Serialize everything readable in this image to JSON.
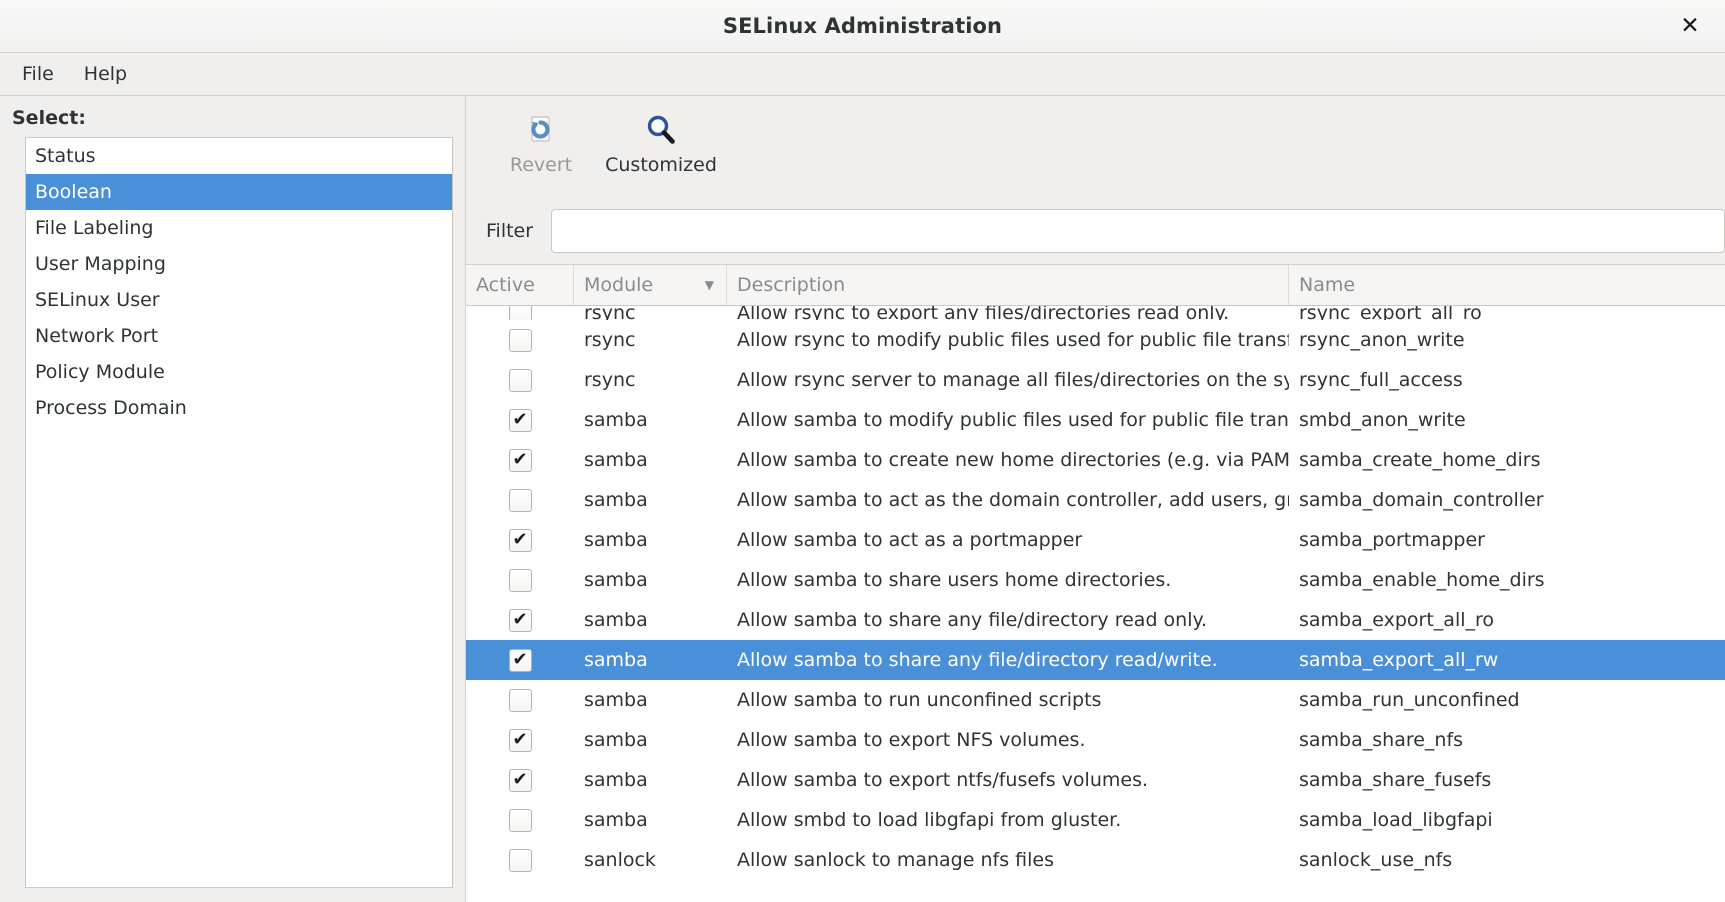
{
  "window": {
    "title": "SELinux Administration",
    "close_icon": "close-icon",
    "close_glyph": "✕"
  },
  "menubar": {
    "items": [
      {
        "label": "File"
      },
      {
        "label": "Help"
      }
    ]
  },
  "sidebar": {
    "select_label": "Select:",
    "items": [
      {
        "label": "Status",
        "selected": false
      },
      {
        "label": "Boolean",
        "selected": true
      },
      {
        "label": "File Labeling",
        "selected": false
      },
      {
        "label": "User Mapping",
        "selected": false
      },
      {
        "label": "SELinux User",
        "selected": false
      },
      {
        "label": "Network Port",
        "selected": false
      },
      {
        "label": "Policy Module",
        "selected": false
      },
      {
        "label": "Process Domain",
        "selected": false
      }
    ]
  },
  "toolbar": {
    "buttons": [
      {
        "label": "Revert",
        "icon": "revert-icon",
        "enabled": false
      },
      {
        "label": "Customized",
        "icon": "magnifier-icon",
        "enabled": true
      }
    ]
  },
  "filter": {
    "label": "Filter",
    "value": "",
    "placeholder": ""
  },
  "table": {
    "columns": [
      {
        "key": "active",
        "label": "Active",
        "sorted": false
      },
      {
        "key": "module",
        "label": "Module",
        "sorted": true,
        "sort_dir": "desc",
        "sort_glyph": "▼"
      },
      {
        "key": "description",
        "label": "Description",
        "sorted": false
      },
      {
        "key": "name",
        "label": "Name",
        "sorted": false
      }
    ],
    "rows": [
      {
        "active": false,
        "module": "rsync",
        "description": "Allow rsync to export any files/directories read only.",
        "name": "rsync_export_all_ro",
        "selected": false,
        "clipped": true
      },
      {
        "active": false,
        "module": "rsync",
        "description": "Allow rsync to modify public files used for public file transfer services.",
        "name": "rsync_anon_write",
        "selected": false
      },
      {
        "active": false,
        "module": "rsync",
        "description": "Allow rsync server to manage all files/directories on the system.",
        "name": "rsync_full_access",
        "selected": false
      },
      {
        "active": true,
        "module": "samba",
        "description": "Allow samba to modify public files used for public file transfer services.",
        "name": "smbd_anon_write",
        "selected": false
      },
      {
        "active": true,
        "module": "samba",
        "description": "Allow samba to create new home directories (e.g. via PAM)",
        "name": "samba_create_home_dirs",
        "selected": false
      },
      {
        "active": false,
        "module": "samba",
        "description": "Allow samba to act as the domain controller, add users, groups and change passwords.",
        "name": "samba_domain_controller",
        "selected": false
      },
      {
        "active": true,
        "module": "samba",
        "description": "Allow samba to act as a portmapper",
        "name": "samba_portmapper",
        "selected": false
      },
      {
        "active": false,
        "module": "samba",
        "description": "Allow samba to share users home directories.",
        "name": "samba_enable_home_dirs",
        "selected": false
      },
      {
        "active": true,
        "module": "samba",
        "description": "Allow samba to share any file/directory read only.",
        "name": "samba_export_all_ro",
        "selected": false
      },
      {
        "active": true,
        "module": "samba",
        "description": "Allow samba to share any file/directory read/write.",
        "name": "samba_export_all_rw",
        "selected": true
      },
      {
        "active": false,
        "module": "samba",
        "description": "Allow samba to run unconfined scripts",
        "name": "samba_run_unconfined",
        "selected": false
      },
      {
        "active": true,
        "module": "samba",
        "description": "Allow samba to export NFS volumes.",
        "name": "samba_share_nfs",
        "selected": false
      },
      {
        "active": true,
        "module": "samba",
        "description": "Allow samba to export ntfs/fusefs volumes.",
        "name": "samba_share_fusefs",
        "selected": false
      },
      {
        "active": false,
        "module": "samba",
        "description": "Allow smbd to load libgfapi from gluster.",
        "name": "samba_load_libgfapi",
        "selected": false
      },
      {
        "active": false,
        "module": "sanlock",
        "description": "Allow sanlock to manage nfs files",
        "name": "sanlock_use_nfs",
        "selected": false
      }
    ]
  },
  "colors": {
    "selection": "#4a90d9",
    "window_bg": "#f1efee",
    "text": "#2e3436",
    "muted_text": "#8b8b8b",
    "accent_icon": "#3465a4"
  }
}
